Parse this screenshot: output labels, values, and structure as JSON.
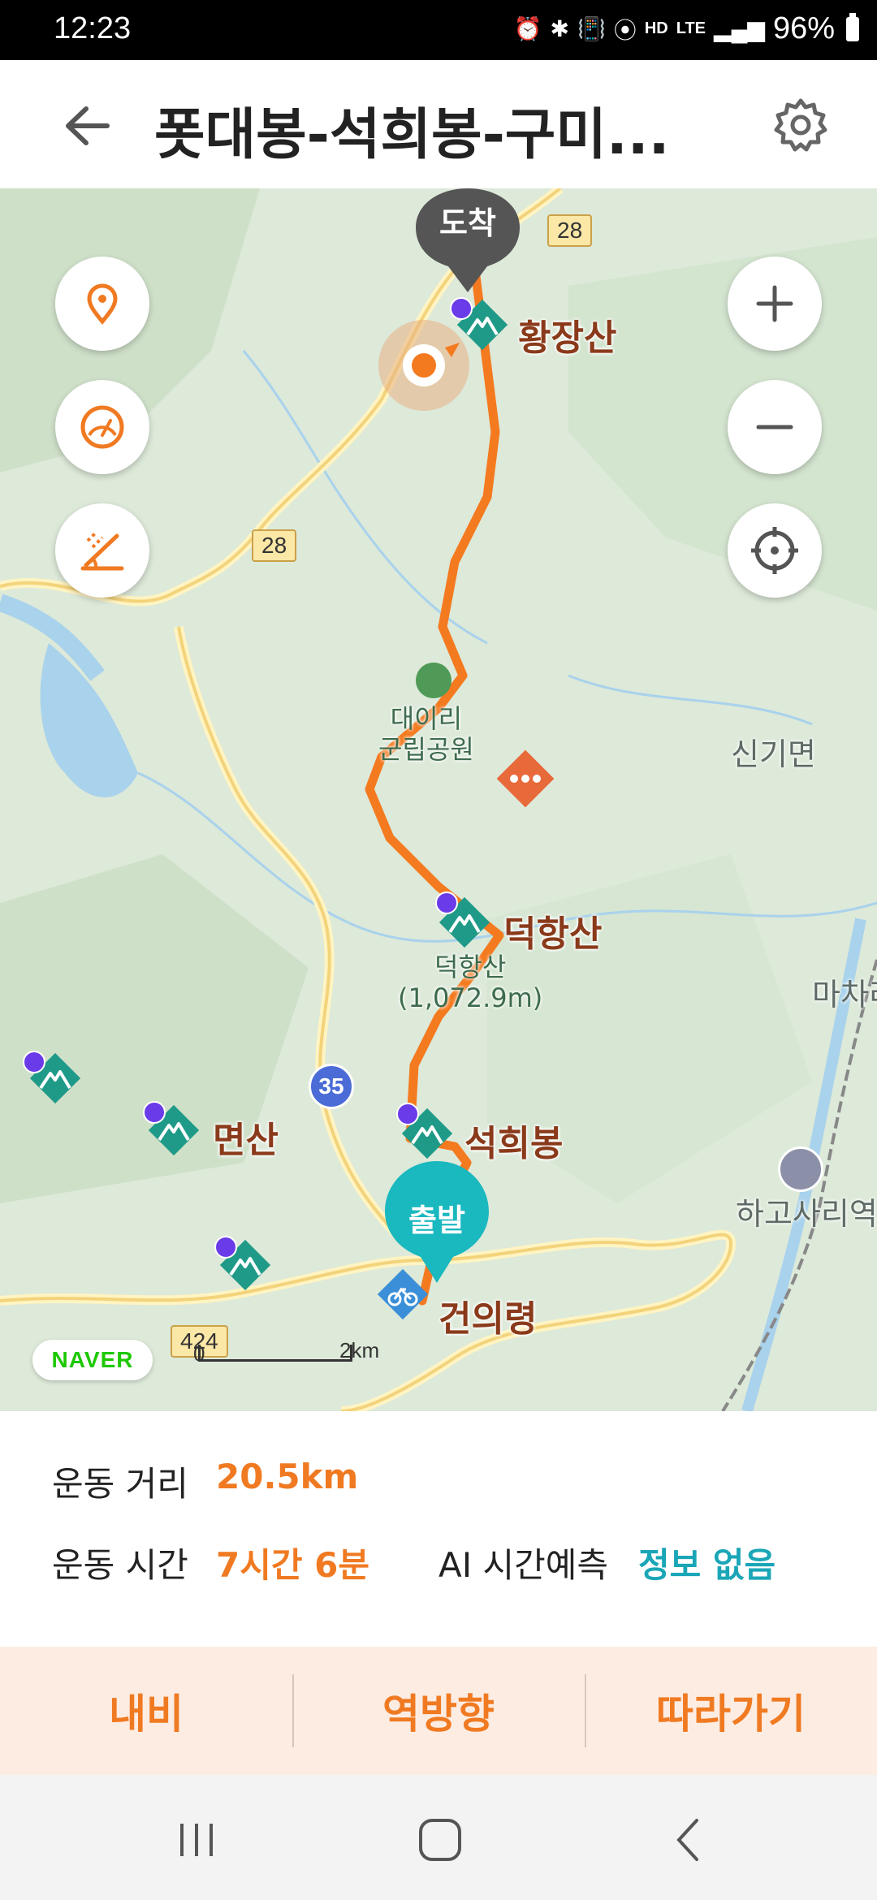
{
  "status_bar": {
    "time": "12:23",
    "icons": [
      "alarm-icon",
      "bluetooth-icon",
      "vibrate-icon",
      "location-icon",
      "hd-voice-icon",
      "lte-icon",
      "signal-icon"
    ],
    "hd": "HD",
    "lte": "LTE",
    "battery": "96%"
  },
  "header": {
    "title": "폿대봉-석희봉-구미...",
    "back_icon": "back-arrow-icon",
    "settings_icon": "gear-icon"
  },
  "map": {
    "end_marker": "도착",
    "start_marker": "출발",
    "peaks": [
      "황장산",
      "덕항산",
      "석희봉",
      "면산",
      "건의령"
    ],
    "park_label": "대이리\n군립공원",
    "peak_detail": "덕항산\n(1,072.9m)",
    "places": [
      "신기면",
      "마차리",
      "하고사리역"
    ],
    "road_badges": [
      "28",
      "28",
      "35",
      "424"
    ],
    "scale_start": "0",
    "scale_end": "2km",
    "logo": "NAVER",
    "left_buttons": [
      "location-pin-icon",
      "speedometer-icon",
      "slope-icon"
    ],
    "right_buttons": [
      "zoom-in-icon",
      "zoom-out-icon",
      "crosshair-icon"
    ]
  },
  "info": {
    "distance_label": "운동 거리",
    "distance_value": "20.5km",
    "time_label": "운동 시간",
    "time_value": "7시간 6분",
    "ai_label": "AI 시간예측",
    "ai_value": "정보 없음"
  },
  "actions": {
    "nav": "내비",
    "reverse": "역방향",
    "follow": "따라가기"
  },
  "colors": {
    "accent": "#f07a22",
    "teal": "#1aa6b7",
    "peak_green": "#1f9a88",
    "route": "#f47a20"
  }
}
